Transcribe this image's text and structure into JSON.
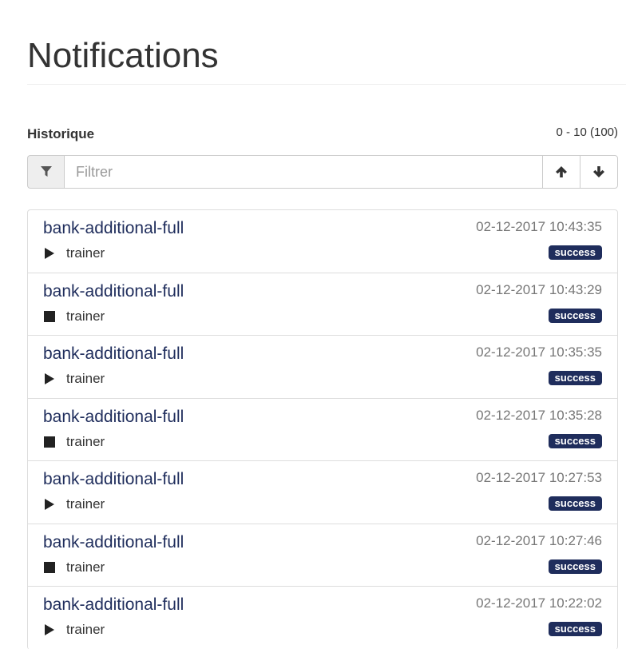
{
  "page": {
    "title": "Notifications"
  },
  "history": {
    "label": "Historique",
    "range": "0 - 10 (100)",
    "filter": {
      "placeholder": "Filtrer",
      "value": ""
    },
    "sort_up_icon": "arrow-up-icon",
    "sort_down_icon": "arrow-down-icon"
  },
  "colors": {
    "accent": "#1f2d5c",
    "badge": "#1f2d5c"
  },
  "items": [
    {
      "name": "bank-additional-full",
      "date": "02-12-2017 10:43:35",
      "type": "trainer",
      "icon": "play-icon",
      "status": "success"
    },
    {
      "name": "bank-additional-full",
      "date": "02-12-2017 10:43:29",
      "type": "trainer",
      "icon": "stop-icon",
      "status": "success"
    },
    {
      "name": "bank-additional-full",
      "date": "02-12-2017 10:35:35",
      "type": "trainer",
      "icon": "play-icon",
      "status": "success"
    },
    {
      "name": "bank-additional-full",
      "date": "02-12-2017 10:35:28",
      "type": "trainer",
      "icon": "stop-icon",
      "status": "success"
    },
    {
      "name": "bank-additional-full",
      "date": "02-12-2017 10:27:53",
      "type": "trainer",
      "icon": "play-icon",
      "status": "success"
    },
    {
      "name": "bank-additional-full",
      "date": "02-12-2017 10:27:46",
      "type": "trainer",
      "icon": "stop-icon",
      "status": "success"
    },
    {
      "name": "bank-additional-full",
      "date": "02-12-2017 10:22:02",
      "type": "trainer",
      "icon": "play-icon",
      "status": "success"
    }
  ]
}
